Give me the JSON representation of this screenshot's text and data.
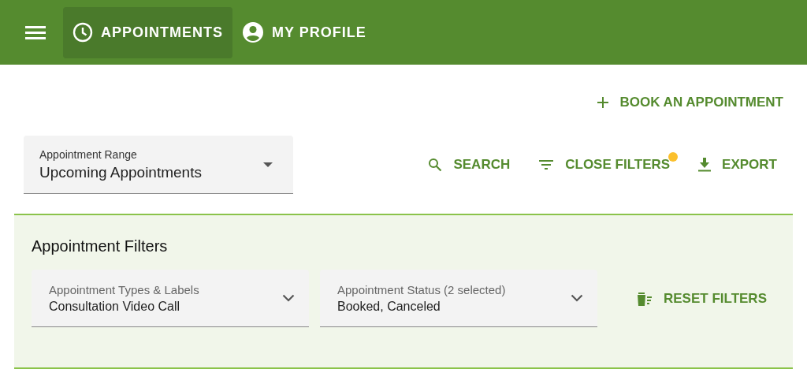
{
  "nav": [
    {
      "kind": "clock",
      "label": "APPOINTMENTS",
      "selected": true
    },
    {
      "kind": "person",
      "label": "MY PROFILE",
      "selected": false
    }
  ],
  "book_button": {
    "label": "BOOK AN APPOINTMENT"
  },
  "range_select": {
    "label": "Appointment Range",
    "value": "Upcoming Appointments"
  },
  "actions": [
    {
      "kind": "search",
      "label": "SEARCH",
      "badge": false
    },
    {
      "kind": "filter",
      "label": "CLOSE FILTERS",
      "badge": true
    },
    {
      "kind": "download",
      "label": "EXPORT",
      "badge": false
    }
  ],
  "filters": {
    "title": "Appointment Filters",
    "selects": [
      {
        "label": "Appointment Types & Labels",
        "value": "Consultation Video Call"
      },
      {
        "label": "Appointment Status (2 selected)",
        "value": "Booked, Canceled"
      }
    ],
    "reset_button": {
      "label": "RESET FILTERS"
    }
  }
}
